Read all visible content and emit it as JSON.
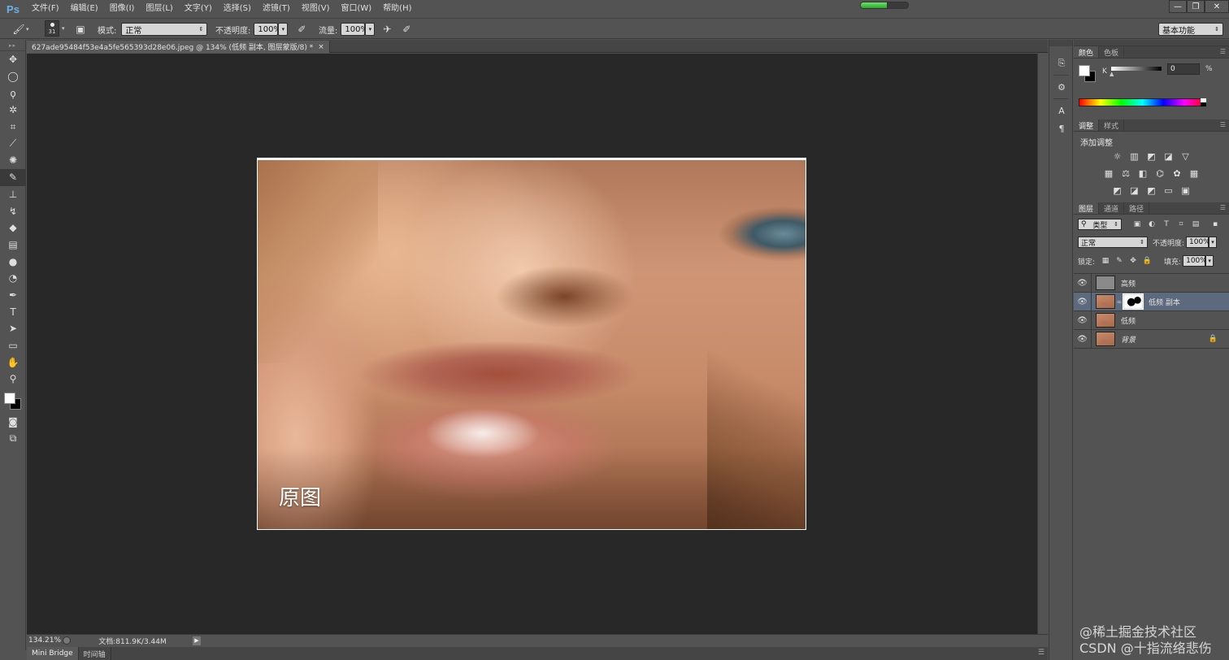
{
  "app": {
    "logo": "Ps",
    "menu": [
      "文件(F)",
      "编辑(E)",
      "图像(I)",
      "图层(L)",
      "文字(Y)",
      "选择(S)",
      "滤镜(T)",
      "视图(V)",
      "窗口(W)",
      "帮助(H)"
    ],
    "progress": 0.55,
    "window_controls": [
      "—",
      "❐",
      "✕"
    ]
  },
  "options": {
    "brush_size": "31",
    "mode_label": "模式:",
    "mode_value": "正常",
    "opacity_label": "不透明度:",
    "opacity_value": "100%",
    "flow_label": "流量:",
    "flow_value": "100%",
    "workspace": "基本功能"
  },
  "document": {
    "tab_title": "627ade95484f53e4a5fe565393d28e06.jpeg @ 134% (低频 副本, 图层蒙版/8) *",
    "tab_close": "×",
    "image_label": "原图"
  },
  "status": {
    "zoom": "134.21%",
    "doc_info": "文档:811.9K/3.44M",
    "arrow": "▶"
  },
  "bottom_tabs": [
    "Mini Bridge",
    "时间轴"
  ],
  "color_panel": {
    "tabs": [
      "颜色",
      "色板"
    ],
    "channel": "K",
    "value": "0",
    "unit": "%"
  },
  "adjustments": {
    "tabs": [
      "调整",
      "样式"
    ],
    "title": "添加调整"
  },
  "layers_panel": {
    "tabs": [
      "图层",
      "通道",
      "路径"
    ],
    "filter_kind": "类型",
    "blend_mode": "正常",
    "opacity_label": "不透明度:",
    "opacity_value": "100%",
    "lock_label": "锁定:",
    "fill_label": "填充:",
    "fill_value": "100%",
    "layers": [
      {
        "name": "高频"
      },
      {
        "name": "低频 副本"
      },
      {
        "name": "低频"
      },
      {
        "name": "背景"
      }
    ]
  },
  "watermark": {
    "line1": "@稀土掘金技术社区",
    "line2": "CSDN @十指流络悲伤"
  },
  "icons": {
    "tools": [
      "move-icon",
      "marquee-icon",
      "lasso-icon",
      "magic-wand-icon",
      "crop-icon",
      "eyedropper-icon",
      "healing-brush-icon",
      "brush-icon",
      "clone-stamp-icon",
      "history-brush-icon",
      "eraser-icon",
      "gradient-icon",
      "blur-icon",
      "dodge-icon",
      "pen-icon",
      "type-icon",
      "path-selection-icon",
      "rectangle-icon",
      "hand-icon",
      "zoom-icon"
    ]
  }
}
